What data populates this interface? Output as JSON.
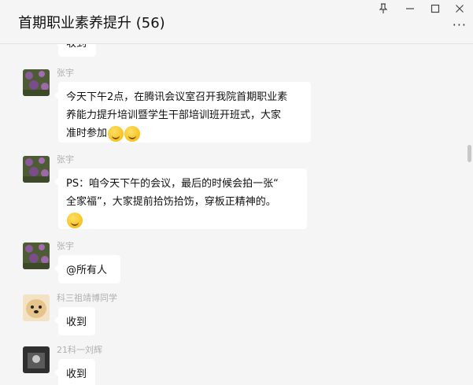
{
  "window": {
    "title": "首期职业素养提升 (56)",
    "more_label": "···"
  },
  "messages": [
    {
      "sender": "",
      "text": "收到"
    },
    {
      "sender": "张宇",
      "text_lines": [
        "今天下午2点，在腾讯会议室召开我院首期职业素",
        "养能力提升培训暨学生干部培训班开班式，大家",
        "准时参加"
      ],
      "emojis": [
        "thinking-face-icon",
        "thinking-face-icon"
      ]
    },
    {
      "sender": "张宇",
      "text_lines": [
        "PS：咱今天下午的会议，最后的时候会拍一张“",
        "全家福”，大家提前拾饬拾饬，穿板正精神的。"
      ],
      "emojis": [
        "grinning-face-icon"
      ]
    },
    {
      "sender": "张宇",
      "text": "@所有人"
    },
    {
      "sender": "科三祖靖博同学",
      "text": "收到"
    },
    {
      "sender": "21科一刘辉",
      "text": "收到"
    }
  ],
  "colors": {
    "background": "#f5f5f5",
    "bubble": "#ffffff",
    "sender_name": "#b0b0b0",
    "emoji": "#f4b400"
  }
}
